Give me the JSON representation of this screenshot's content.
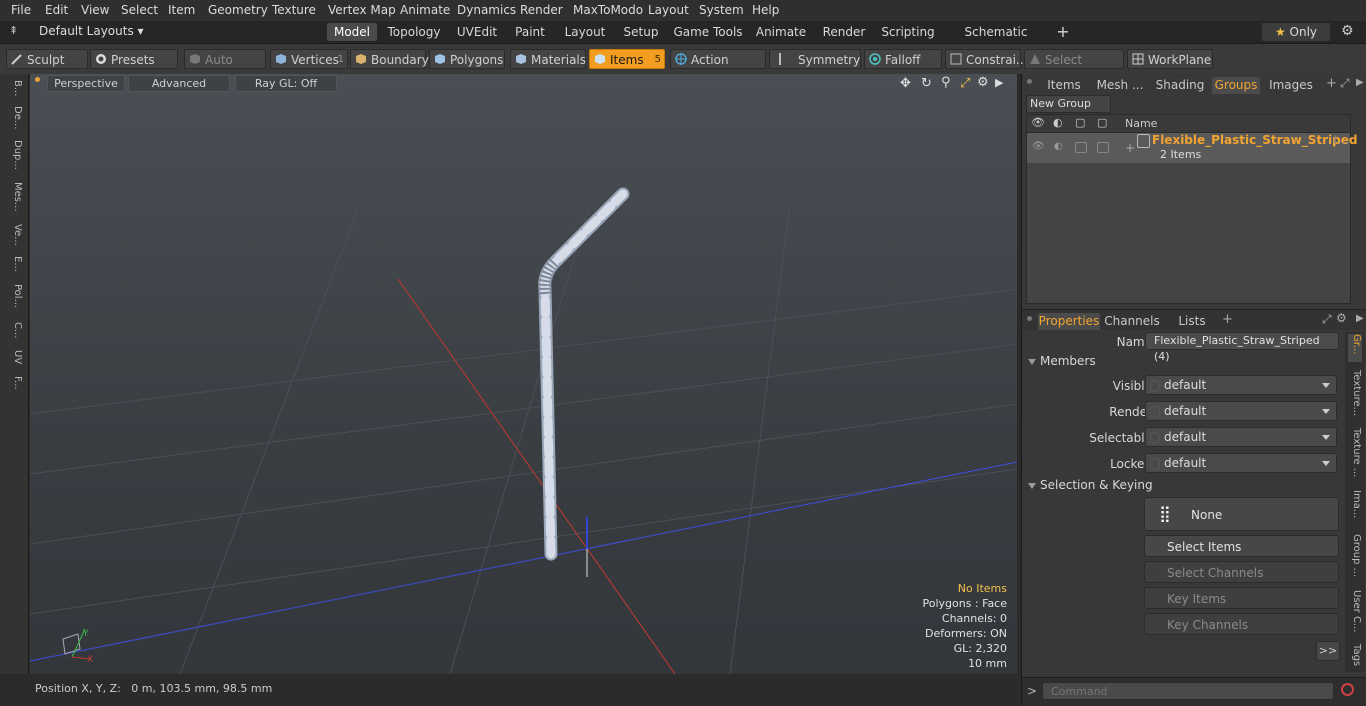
{
  "menu": [
    "File",
    "Edit",
    "View",
    "Select",
    "Item",
    "Geometry",
    "Texture",
    "Vertex Map",
    "Animate",
    "Dynamics",
    "Render",
    "MaxToModo",
    "Layout",
    "System",
    "Help"
  ],
  "layout": {
    "selector": "Default Layouts",
    "tabs": [
      "Model",
      "Topology",
      "UVEdit",
      "Paint",
      "Layout",
      "Setup",
      "Game Tools",
      "Animate",
      "Render",
      "Scripting",
      "Schematic Fusion"
    ],
    "active_tab": "Model",
    "add": "+",
    "only": "Only"
  },
  "toolbar": {
    "sculpt": "Sculpt",
    "presets": "Presets",
    "auto_select": "Auto Select",
    "vertices": "Vertices",
    "vertices_count": "1",
    "boundary": "Boundary",
    "polygons": "Polygons",
    "materials": "Materials",
    "items": "Items",
    "items_count": "5",
    "action_center": "Action Center",
    "symmetry": "Symmetry",
    "falloff": "Falloff",
    "constraints": "Constrai...",
    "select_through": "Select Through",
    "workplane": "WorkPlane"
  },
  "left_tools": [
    "B...",
    "De...",
    "Dup...",
    "Mes...",
    "Ve...",
    "E...",
    "Pol...",
    "C...",
    "UV",
    "F..."
  ],
  "viewport": {
    "perspective": "Perspective",
    "advanced": "Advanced",
    "raygl": "Ray GL: Off",
    "info": {
      "selection": "No Items",
      "polygons": "Polygons : Face",
      "channels": "Channels: 0",
      "deformers": "Deformers: ON",
      "gl": "GL: 2,320",
      "scale": "10 mm"
    },
    "axis_y": "Y",
    "axis_x": "X"
  },
  "status": {
    "position": "Position X, Y, Z:   0 m, 103.5 mm, 98.5 mm"
  },
  "top_panel": {
    "tabs": [
      "Items",
      "Mesh ...",
      "Shading",
      "Groups",
      "Images"
    ],
    "active_tab": "Groups",
    "new_group": "New Group",
    "name_col": "Name",
    "group_name": "Flexible_Plastic_Straw_Striped",
    "group_suffix": "(...",
    "group_count": "2 Items"
  },
  "properties": {
    "tabs": [
      "Properties",
      "Channels",
      "Lists"
    ],
    "active_tab": "Properties",
    "name_label": "Name",
    "name_value": "Flexible_Plastic_Straw_Striped (4)",
    "members": "Members",
    "rows": [
      {
        "label": "Visible",
        "value": "default"
      },
      {
        "label": "Render",
        "value": "default"
      },
      {
        "label": "Selectable",
        "value": "default"
      },
      {
        "label": "Locked",
        "value": "default"
      }
    ],
    "selection_keying": "Selection & Keying",
    "none_btn": "None",
    "select_items": "Select Items",
    "select_channels": "Select Channels",
    "key_items": "Key Items",
    "key_channels": "Key Channels",
    "more": ">>",
    "side_tabs": [
      "Gr...",
      "Texture...",
      "Texture ...",
      "Ima...",
      "Group ...",
      "User C...",
      "Tags"
    ]
  },
  "command": {
    "prompt": ">",
    "placeholder": "Command"
  },
  "colors": {
    "accent": "#f29d1f",
    "group_text": "#f2a431"
  }
}
